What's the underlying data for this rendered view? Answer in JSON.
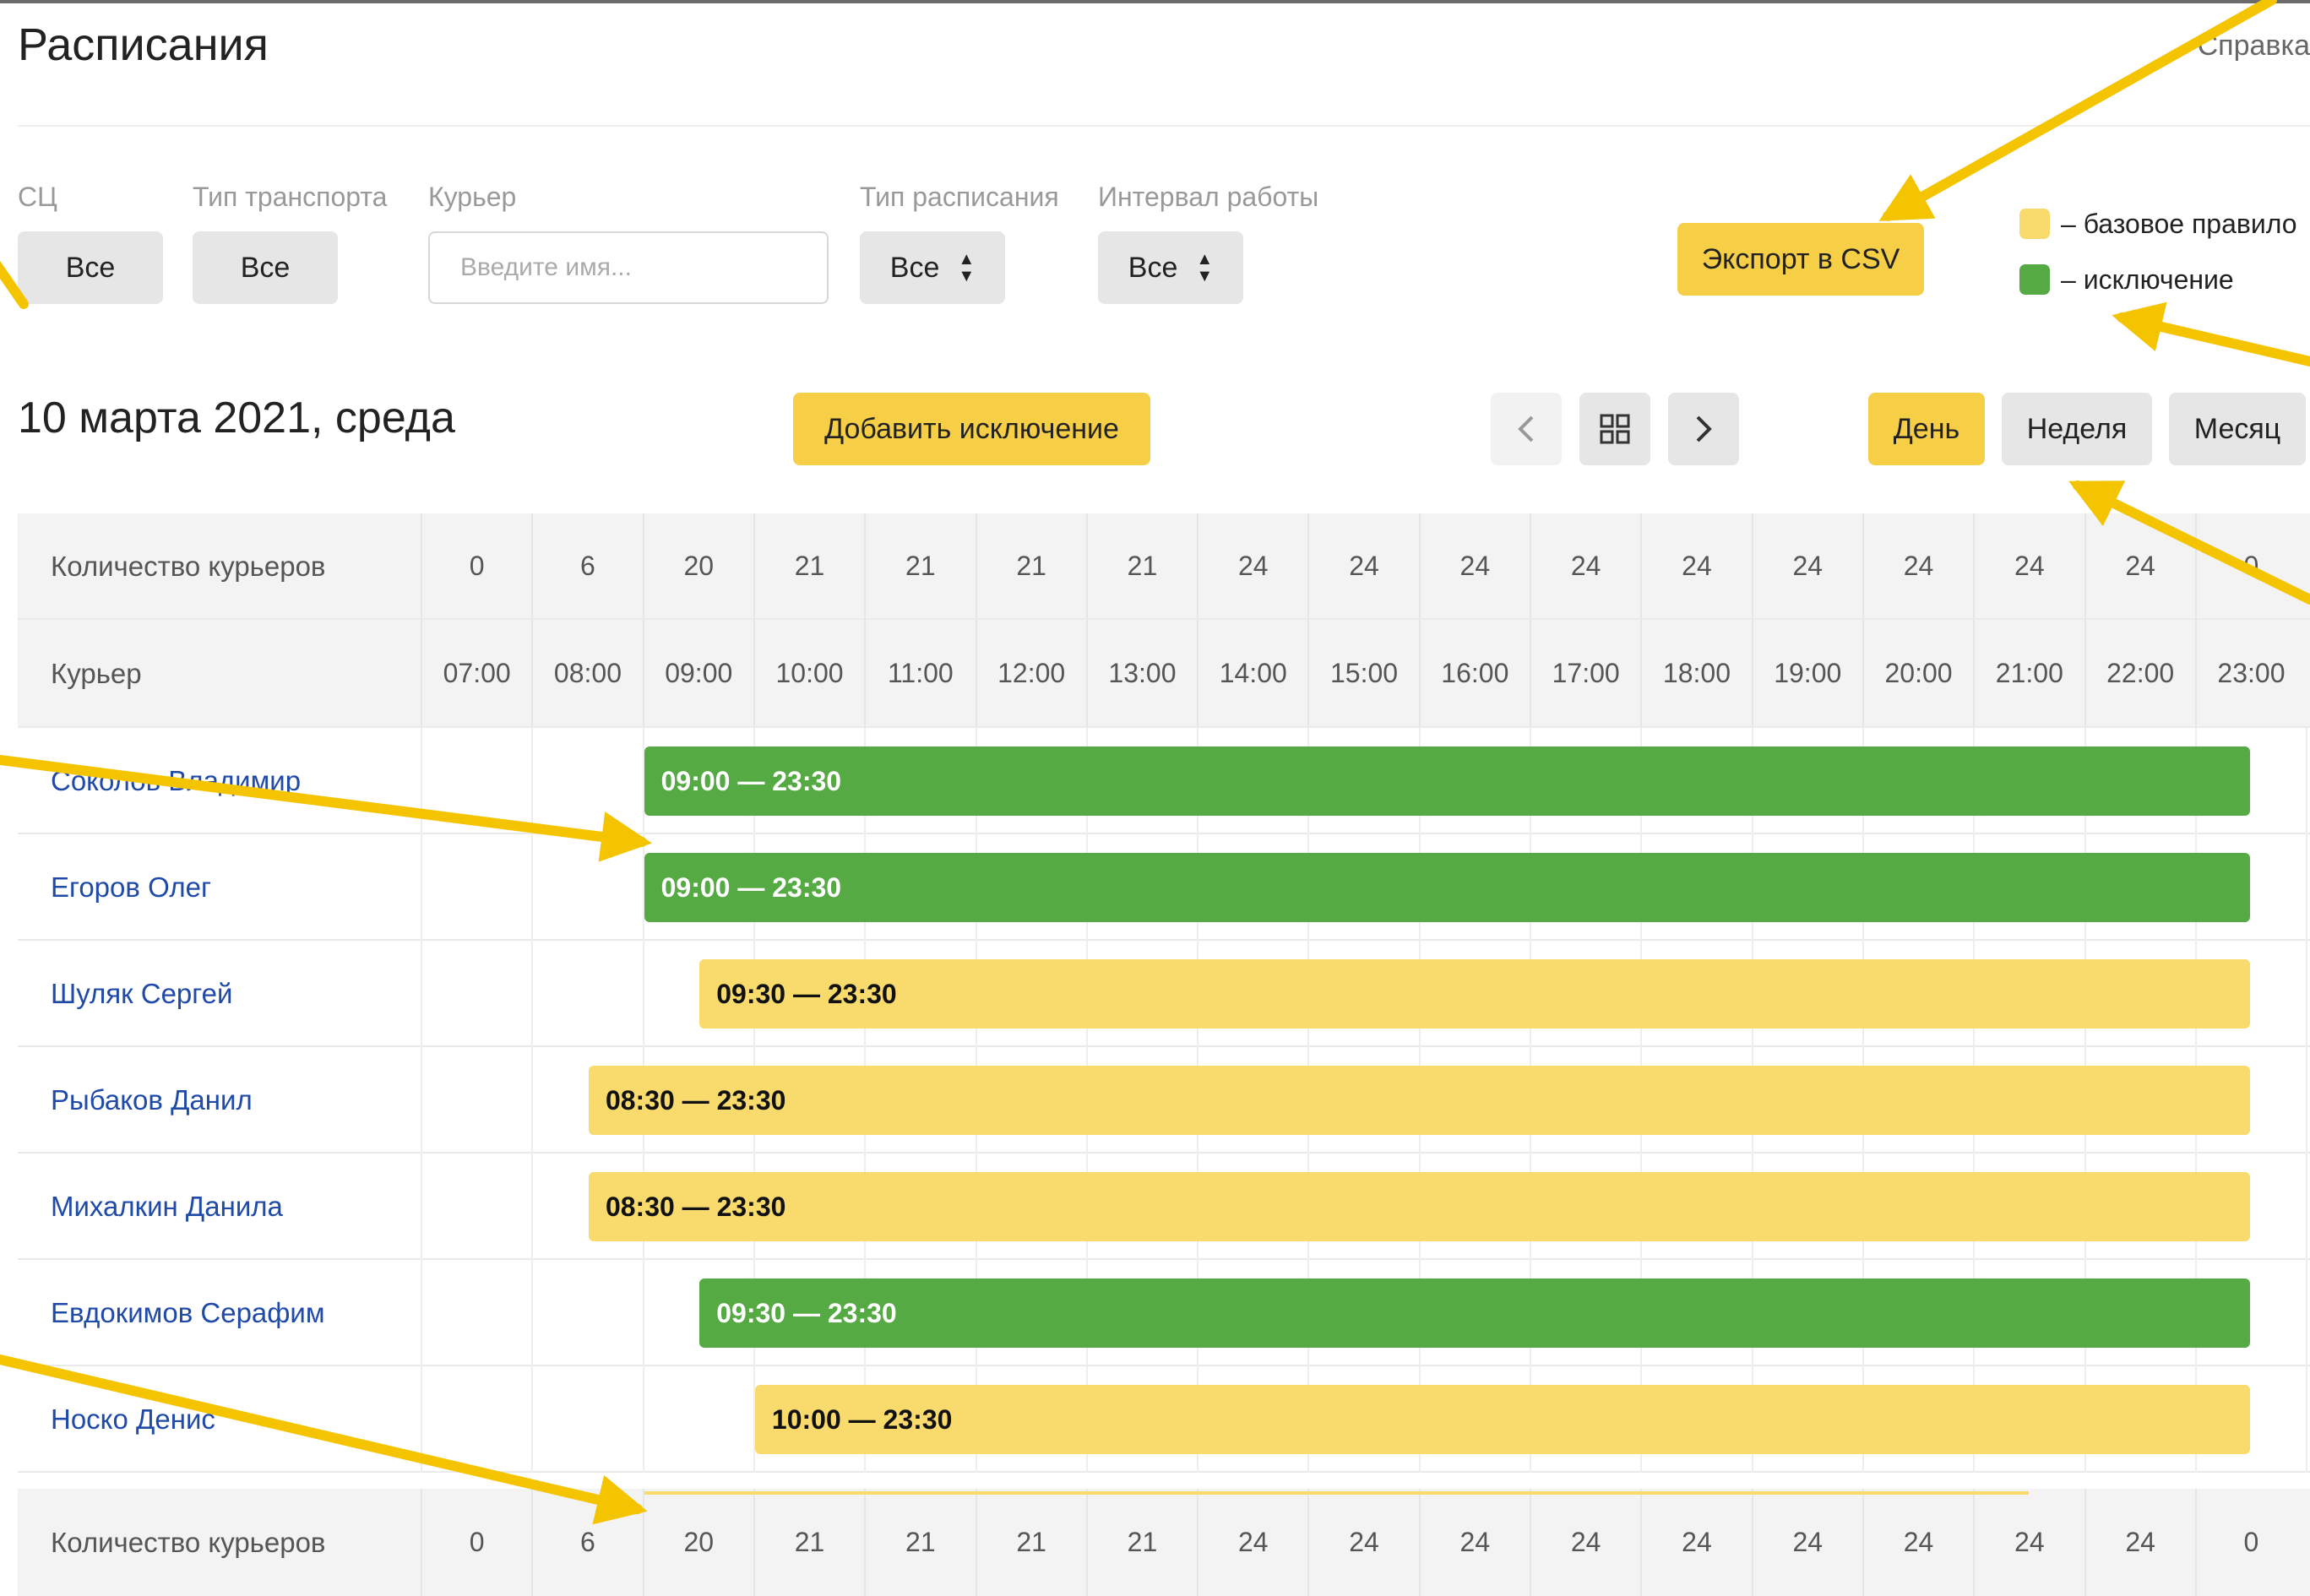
{
  "header": {
    "title": "Расписания",
    "help": "Справка"
  },
  "filters": {
    "sc": {
      "label": "СЦ",
      "value": "Все"
    },
    "transport": {
      "label": "Тип транспорта",
      "value": "Все"
    },
    "courier": {
      "label": "Курьер",
      "placeholder": "Введите имя..."
    },
    "schedule_type": {
      "label": "Тип расписания",
      "value": "Все"
    },
    "interval": {
      "label": "Интервал работы",
      "value": "Все"
    }
  },
  "export_button": "Экспорт в CSV",
  "legend": {
    "base": {
      "text": "– базовое правило",
      "color": "#f8db6c"
    },
    "exception": {
      "text": "– исключение",
      "color": "#56aa44"
    }
  },
  "toolbar": {
    "date": "10 марта 2021, среда",
    "add_exception": "Добавить исключение",
    "prev_icon": "chevron-left-icon",
    "grid_icon": "grid-icon",
    "next_icon": "chevron-right-icon",
    "views": {
      "day": "День",
      "week": "Неделя",
      "month": "Месяц"
    },
    "active_view": "День"
  },
  "table": {
    "count_label": "Количество курьеров",
    "courier_label": "Курьер",
    "hours": [
      "07:00",
      "08:00",
      "09:00",
      "10:00",
      "11:00",
      "12:00",
      "13:00",
      "14:00",
      "15:00",
      "16:00",
      "17:00",
      "18:00",
      "19:00",
      "20:00",
      "21:00",
      "22:00",
      "23:00"
    ],
    "counts_top": [
      "0",
      "6",
      "20",
      "21",
      "21",
      "21",
      "21",
      "24",
      "24",
      "24",
      "24",
      "24",
      "24",
      "24",
      "24",
      "24",
      "0"
    ],
    "counts_bottom": [
      "0",
      "6",
      "20",
      "21",
      "21",
      "21",
      "21",
      "24",
      "24",
      "24",
      "24",
      "24",
      "24",
      "24",
      "24",
      "24",
      "0"
    ],
    "couriers": [
      {
        "name": "Соколов Владимир",
        "shift": "09:00 — 23:30",
        "type": "exception",
        "start": 9.0,
        "end": 23.5
      },
      {
        "name": "Егоров Олег",
        "shift": "09:00 — 23:30",
        "type": "exception",
        "start": 9.0,
        "end": 23.5
      },
      {
        "name": "Шуляк Сергей",
        "shift": "09:30 — 23:30",
        "type": "base",
        "start": 9.5,
        "end": 23.5
      },
      {
        "name": "Рыбаков Данил",
        "shift": "08:30 — 23:30",
        "type": "base",
        "start": 8.5,
        "end": 23.5
      },
      {
        "name": "Михалкин Данила",
        "shift": "08:30 — 23:30",
        "type": "base",
        "start": 8.5,
        "end": 23.5
      },
      {
        "name": "Евдокимов Серафим",
        "shift": "09:30 — 23:30",
        "type": "exception",
        "start": 9.5,
        "end": 23.5
      },
      {
        "name": "Носко Денис",
        "shift": "10:00 — 23:30",
        "type": "base",
        "start": 10.0,
        "end": 23.5
      }
    ]
  },
  "colors": {
    "accent_yellow": "#f6cf47",
    "exception_green": "#56aa44",
    "base_yellow": "#f8db6c",
    "link_blue": "#1f4aa8",
    "annotation_arrow": "#f5c400"
  }
}
